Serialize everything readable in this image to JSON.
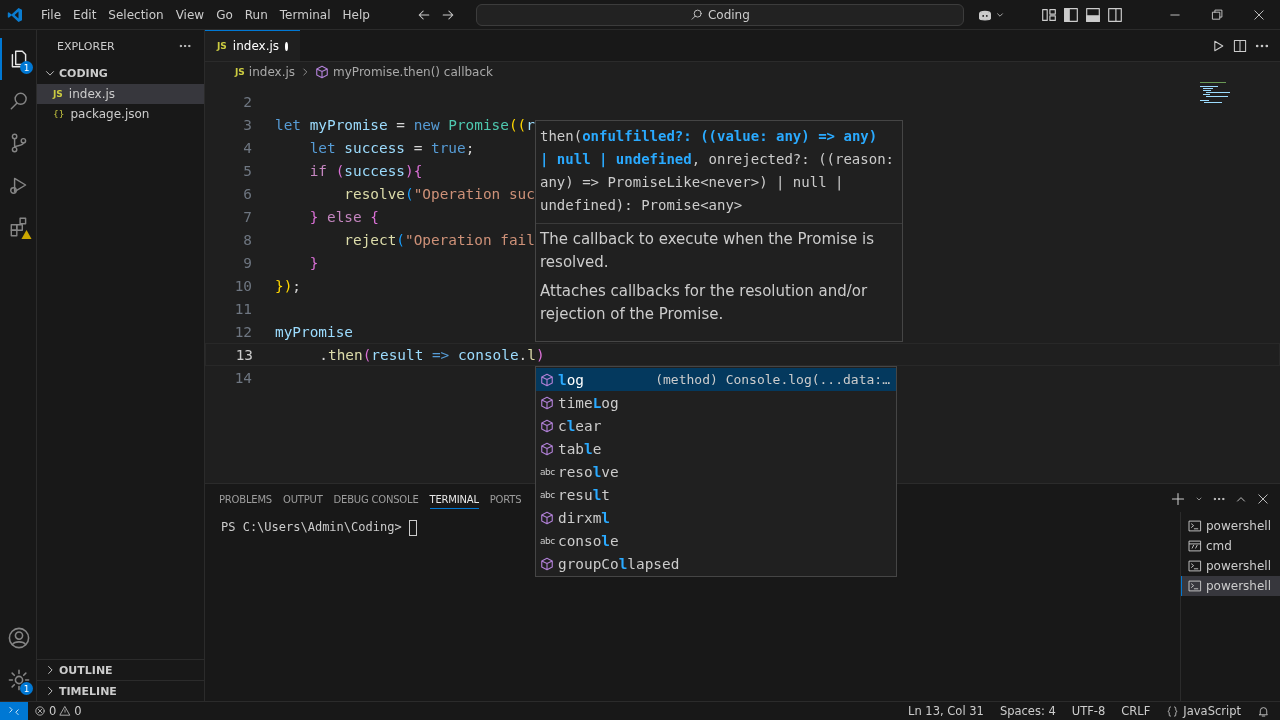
{
  "title_bar": {
    "menus": [
      "File",
      "Edit",
      "Selection",
      "View",
      "Go",
      "Run",
      "Terminal",
      "Help"
    ],
    "search": "Coding"
  },
  "activity_bar": {
    "top": [
      {
        "kind": "files",
        "badge": "1",
        "selected": true
      },
      {
        "kind": "search",
        "selected": false
      },
      {
        "kind": "source-control",
        "selected": false
      },
      {
        "kind": "run",
        "selected": false
      },
      {
        "kind": "extensions",
        "selected": false
      }
    ],
    "bottom": [
      {
        "kind": "account"
      },
      {
        "kind": "settings",
        "badge": "1"
      }
    ]
  },
  "sidebar": {
    "title": "EXPLORER",
    "folder": "CODING",
    "files": [
      {
        "badge": "JS",
        "name": "index.js",
        "selected": true
      },
      {
        "badge": "{}",
        "name": "package.json",
        "selected": false
      }
    ],
    "sections": [
      "OUTLINE",
      "TIMELINE"
    ]
  },
  "tabs": [
    {
      "badge": "JS",
      "name": "index.js",
      "modified": true,
      "selected": true
    }
  ],
  "breadcrumb": {
    "badge": "JS",
    "file": "index.js",
    "symbol": "myPromise.then() callback"
  },
  "code": [
    {
      "number": "2",
      "current": false
    },
    {
      "number": "3",
      "current": false,
      "tokens": [
        {
          "text": "let ",
          "kind": "keyword"
        },
        {
          "text": "myPromise",
          "kind": "variable"
        },
        {
          "text": " = ",
          "kind": "plain"
        },
        {
          "text": "new ",
          "kind": "keyword"
        },
        {
          "text": "Promise",
          "kind": "class"
        },
        {
          "text": "((",
          "kind": "bracket"
        },
        {
          "text": "r",
          "kind": "variable"
        }
      ]
    },
    {
      "number": "4",
      "current": false,
      "tokens": [
        {
          "text": "    let ",
          "kind": "keyword"
        },
        {
          "text": "success",
          "kind": "variable"
        },
        {
          "text": " = ",
          "kind": "plain"
        },
        {
          "text": "true",
          "kind": "keyword"
        },
        {
          "text": ";",
          "kind": "plain"
        }
      ]
    },
    {
      "number": "5",
      "current": false,
      "tokens": [
        {
          "text": "    if ",
          "kind": "control"
        },
        {
          "text": "(",
          "kind": "bracket2"
        },
        {
          "text": "success",
          "kind": "variable"
        },
        {
          "text": "){",
          "kind": "bracket2"
        }
      ]
    },
    {
      "number": "6",
      "current": false,
      "tokens": [
        {
          "text": "        resolve",
          "kind": "function"
        },
        {
          "text": "(",
          "kind": "bracket3"
        },
        {
          "text": "\"Operation suc",
          "kind": "string"
        }
      ]
    },
    {
      "number": "7",
      "current": false,
      "tokens": [
        {
          "text": "    } ",
          "kind": "bracket2"
        },
        {
          "text": "else ",
          "kind": "control"
        },
        {
          "text": "{",
          "kind": "bracket2"
        }
      ]
    },
    {
      "number": "8",
      "current": false,
      "tokens": [
        {
          "text": "        reject",
          "kind": "function"
        },
        {
          "text": "(",
          "kind": "bracket3"
        },
        {
          "text": "\"Operation fail",
          "kind": "string"
        }
      ]
    },
    {
      "number": "9",
      "current": false,
      "tokens": [
        {
          "text": "    }",
          "kind": "bracket2"
        }
      ]
    },
    {
      "number": "10",
      "current": false,
      "tokens": [
        {
          "text": "})",
          "kind": "bracket"
        },
        {
          "text": ";",
          "kind": "plain"
        }
      ]
    },
    {
      "number": "11",
      "current": false
    },
    {
      "number": "12",
      "current": false,
      "tokens": [
        {
          "text": "myPromise",
          "kind": "variable"
        }
      ]
    },
    {
      "number": "13",
      "current": true,
      "tokens": [
        {
          "text": "     .",
          "kind": "plain"
        },
        {
          "text": "then",
          "kind": "function"
        },
        {
          "text": "(",
          "kind": "bracket2"
        },
        {
          "text": "result",
          "kind": "variable"
        },
        {
          "text": " => ",
          "kind": "keyword"
        },
        {
          "text": "console",
          "kind": "variable"
        },
        {
          "text": ".",
          "kind": "plain"
        },
        {
          "text": "l",
          "kind": "function"
        },
        {
          "text": ")",
          "kind": "bracket2"
        }
      ]
    },
    {
      "number": "14",
      "current": false
    }
  ],
  "hover": {
    "signature": "then(**onfulfilled?: ((value: any) => any) | null | undefined**, onrejected?: ((reason: any) => PromiseLike<never>) | null | undefined): Promise<any>",
    "docs": [
      "The callback to execute when the Promise is resolved.",
      "Attaches callbacks for the resolution and/or rejection of the Promise."
    ]
  },
  "suggestions": [
    {
      "label": "**l**og",
      "kind": "method",
      "selected": true,
      "detail": "(method) Console.log(...data:…"
    },
    {
      "label": "time**L**og",
      "kind": "method",
      "selected": false
    },
    {
      "label": "c**l**ear",
      "kind": "method",
      "selected": false
    },
    {
      "label": "tab**l**e",
      "kind": "method",
      "selected": false
    },
    {
      "label": "reso**l**ve",
      "kind": "word",
      "icon": "abc",
      "selected": false
    },
    {
      "label": "resu**l**t",
      "kind": "word",
      "icon": "abc",
      "selected": false
    },
    {
      "label": "dirxm**l**",
      "kind": "method",
      "selected": false
    },
    {
      "label": "conso**l**e",
      "kind": "word",
      "icon": "abc",
      "selected": false
    },
    {
      "label": "groupCo**l**lapsed",
      "kind": "method",
      "selected": false
    }
  ],
  "panel": {
    "tabs": [
      {
        "label": "PROBLEMS",
        "selected": false
      },
      {
        "label": "OUTPUT",
        "selected": false
      },
      {
        "label": "DEBUG CONSOLE",
        "selected": false
      },
      {
        "label": "TERMINAL",
        "selected": true
      },
      {
        "label": "PORTS",
        "selected": false
      }
    ],
    "prompt": "PS C:\\Users\\Admin\\Coding> ",
    "terminals": [
      {
        "name": "powershell",
        "kind": "powershell",
        "selected": false
      },
      {
        "name": "cmd",
        "kind": "cmd",
        "selected": false
      },
      {
        "name": "powershell",
        "kind": "powershell",
        "selected": false
      },
      {
        "name": "powershell",
        "kind": "powershell",
        "selected": true
      }
    ]
  },
  "status_bar": {
    "errors": "0",
    "warnings": "0",
    "items": [
      "Ln 13, Col 31",
      "Spaces: 4",
      "UTF-8",
      "CRLF"
    ],
    "language": "JavaScript"
  }
}
